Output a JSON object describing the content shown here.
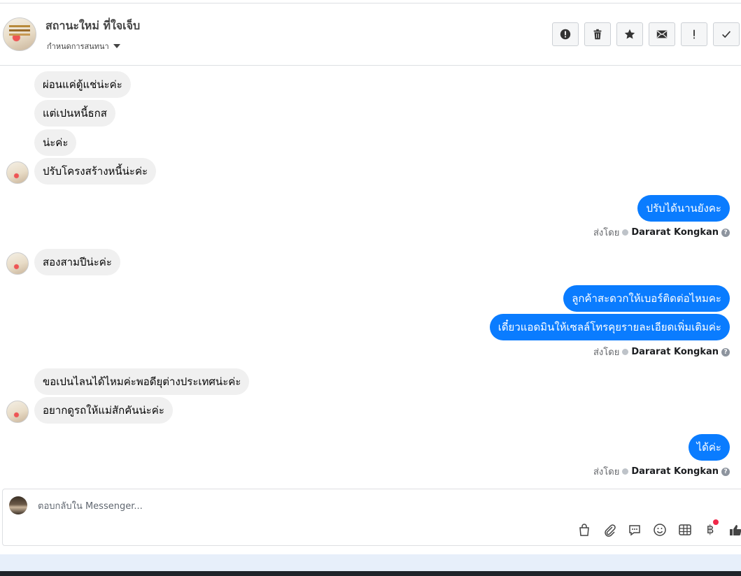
{
  "header": {
    "contact_name": "สถานะใหม่ ที่ใจเจ็บ",
    "assign_label": "กำหนดการสนทนา",
    "actions": [
      {
        "name": "spam-button",
        "icon": "alert-circle-icon"
      },
      {
        "name": "delete-button",
        "icon": "trash-icon"
      },
      {
        "name": "star-button",
        "icon": "star-icon"
      },
      {
        "name": "mark-unread-button",
        "icon": "envelope-icon"
      },
      {
        "name": "follow-up-button",
        "icon": "exclamation-icon"
      },
      {
        "name": "mark-done-button",
        "icon": "checkmark-icon"
      }
    ]
  },
  "messages": [
    {
      "side": "in",
      "text": "ผ่อนแค่ตู้แช่น่ะค่ะ"
    },
    {
      "side": "in",
      "text": "แต่เปนหนี้ธกส"
    },
    {
      "side": "in",
      "text": "น่ะค่ะ"
    },
    {
      "side": "in",
      "text": "ปรับโครงสร้างหนี้น่ะค่ะ"
    },
    {
      "side": "out",
      "text": "ปรับได้นานยังคะ"
    },
    {
      "side": "in",
      "text": "สองสามปีน่ะค่ะ"
    },
    {
      "side": "out",
      "text": "ลูกค้าสะดวกให้เบอร์ติดต่อไหมคะ"
    },
    {
      "side": "out",
      "text": "เดี๋ยวแอดมินให้เซลล์โทรคุยรายละเอียดเพิ่มเติมค่ะ"
    },
    {
      "side": "in",
      "text": "ขอเปนไลนได้ไหมค่ะพอดียุต่างประเทศน่ะค่ะ"
    },
    {
      "side": "in",
      "text": "อยากดูรถให้แม่สักคันน่ะค่ะ"
    },
    {
      "side": "out",
      "text": "ได้ค่ะ"
    }
  ],
  "sent_by": {
    "prefix": "ส่งโดย",
    "agent": "Dararat Kongkan"
  },
  "composer": {
    "placeholder": "ตอบกลับใน Messenger...",
    "tools": [
      "shopping-bag-icon",
      "paperclip-icon",
      "saved-reply-icon",
      "emoji-icon",
      "table-icon",
      "baht-icon",
      "thumbs-up-icon"
    ],
    "baht_symbol": "฿"
  },
  "colors": {
    "outgoing_bubble": "#0a7cff",
    "incoming_bubble": "#f0f0f0",
    "notification_dot": "#f02849"
  }
}
